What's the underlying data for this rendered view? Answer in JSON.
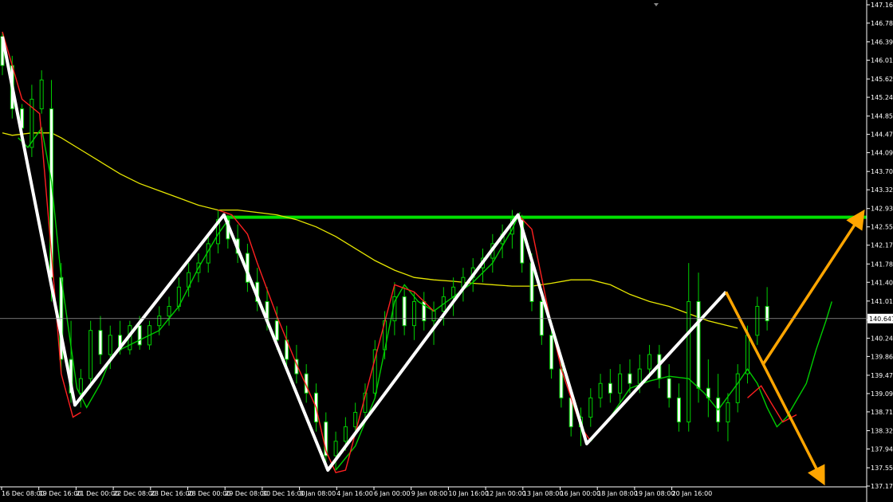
{
  "chart_data": {
    "type": "candlestick",
    "symbol_timeframe": "",
    "background": "#000000",
    "axis_color": "#ffffff",
    "ylim": [
      137.17,
      147.16
    ],
    "price_ticks": [
      "147.160",
      "146.780",
      "146.390",
      "146.010",
      "145.620",
      "145.240",
      "144.850",
      "144.470",
      "144.090",
      "143.700",
      "143.320",
      "142.930",
      "142.550",
      "142.170",
      "141.780",
      "141.400",
      "141.010",
      "140.620",
      "140.240",
      "139.860",
      "139.470",
      "139.090",
      "138.710",
      "138.320",
      "137.940",
      "137.550",
      "137.170"
    ],
    "current_price": {
      "label": "140.647",
      "value": 140.647,
      "color": "#ffffff"
    },
    "time_labels": [
      "16 Dec 08:00",
      "19 Dec 16:00",
      "21 Dec 00:00",
      "22 Dec 08:00",
      "23 Dec 16:00",
      "28 Dec 00:00",
      "29 Dec 08:00",
      "30 Dec 16:00",
      "3 Jan 08:00",
      "4 Jan 16:00",
      "6 Jan 00:00",
      "9 Jan 08:00",
      "10 Jan 16:00",
      "12 Jan 00:00",
      "13 Jan 08:00",
      "16 Jan 00:00",
      "18 Jan 08:00",
      "19 Jan 08:00",
      "20 Jan 16:00"
    ],
    "resistance_level": {
      "value": 142.75,
      "color": "#00e000"
    },
    "ma_long": {
      "color": "#e6e600",
      "points": [
        [
          0,
          144.5
        ],
        [
          0.5,
          144.45
        ],
        [
          1.5,
          144.5
        ],
        [
          2.5,
          144.5
        ],
        [
          3,
          144.4
        ],
        [
          4,
          144.15
        ],
        [
          5,
          143.9
        ],
        [
          6,
          143.65
        ],
        [
          7,
          143.45
        ],
        [
          8,
          143.3
        ],
        [
          9,
          143.15
        ],
        [
          10,
          143.0
        ],
        [
          11,
          142.9
        ],
        [
          12,
          142.9
        ],
        [
          13,
          142.85
        ],
        [
          14,
          142.8
        ],
        [
          15,
          142.7
        ],
        [
          16,
          142.55
        ],
        [
          17,
          142.35
        ],
        [
          18,
          142.1
        ],
        [
          19,
          141.85
        ],
        [
          20,
          141.65
        ],
        [
          21,
          141.5
        ],
        [
          22,
          141.45
        ],
        [
          23,
          141.42
        ],
        [
          24,
          141.38
        ],
        [
          25,
          141.35
        ],
        [
          26,
          141.32
        ],
        [
          27,
          141.32
        ],
        [
          28,
          141.38
        ],
        [
          29,
          141.45
        ],
        [
          30,
          141.45
        ],
        [
          31,
          141.35
        ],
        [
          32,
          141.15
        ],
        [
          33,
          141.0
        ],
        [
          34,
          140.9
        ],
        [
          35,
          140.75
        ],
        [
          36,
          140.6
        ],
        [
          37,
          140.5
        ],
        [
          37.5,
          140.45
        ]
      ]
    },
    "ma_fast_down": {
      "color": "#ff2020",
      "points": [
        [
          0,
          146.6
        ],
        [
          1,
          145.2
        ],
        [
          1.9,
          144.9
        ],
        [
          2.5,
          142.0
        ],
        [
          3,
          139.5
        ],
        [
          3.6,
          138.6
        ],
        [
          4,
          138.7
        ],
        [
          11,
          142.9
        ],
        [
          11.7,
          142.8
        ],
        [
          12.5,
          142.4
        ],
        [
          13,
          141.8
        ],
        [
          14,
          140.7
        ],
        [
          15,
          139.7
        ],
        [
          16,
          138.8
        ],
        [
          16.5,
          137.9
        ],
        [
          17,
          137.45
        ],
        [
          17.5,
          137.5
        ],
        [
          20,
          141.35
        ],
        [
          21,
          141.2
        ],
        [
          21.5,
          141.0
        ],
        [
          22,
          140.8
        ],
        [
          26.3,
          142.8
        ],
        [
          27,
          142.5
        ],
        [
          27.5,
          141.5
        ],
        [
          28,
          140.5
        ],
        [
          28.5,
          139.6
        ],
        [
          29,
          139.0
        ],
        [
          29.5,
          138.4
        ],
        [
          30,
          138.1
        ],
        [
          38,
          139.0
        ],
        [
          38.7,
          139.25
        ],
        [
          39.2,
          138.9
        ],
        [
          39.8,
          138.5
        ],
        [
          40.5,
          138.65
        ]
      ]
    },
    "ma_fast_up": {
      "color": "#00cc00",
      "points": [
        [
          0.8,
          144.4
        ],
        [
          1.3,
          144.2
        ],
        [
          2,
          144.6
        ],
        [
          2.5,
          143.5
        ],
        [
          3,
          141.5
        ],
        [
          3.8,
          139.2
        ],
        [
          4.3,
          138.8
        ],
        [
          5,
          139.3
        ],
        [
          5.5,
          139.8
        ],
        [
          6,
          140.0
        ],
        [
          7,
          140.2
        ],
        [
          8,
          140.4
        ],
        [
          9,
          140.9
        ],
        [
          10,
          141.7
        ],
        [
          11,
          142.4
        ],
        [
          11.7,
          142.8
        ],
        [
          17,
          137.5
        ],
        [
          18,
          138.0
        ],
        [
          19,
          139.0
        ],
        [
          19.5,
          140.0
        ],
        [
          20,
          141.0
        ],
        [
          20.5,
          141.35
        ],
        [
          21.2,
          141.0
        ],
        [
          22,
          140.8
        ],
        [
          23,
          141.1
        ],
        [
          24,
          141.4
        ],
        [
          25,
          141.8
        ],
        [
          26,
          142.5
        ],
        [
          26.4,
          142.85
        ],
        [
          30,
          138.1
        ],
        [
          31,
          138.6
        ],
        [
          32,
          139.2
        ],
        [
          33,
          139.35
        ],
        [
          34,
          139.45
        ],
        [
          35,
          139.4
        ],
        [
          35.8,
          139.1
        ],
        [
          36.5,
          138.75
        ],
        [
          37.5,
          139.3
        ],
        [
          38,
          139.6
        ],
        [
          38.5,
          139.3
        ],
        [
          39,
          138.8
        ],
        [
          39.5,
          138.4
        ],
        [
          40,
          138.6
        ],
        [
          40.5,
          138.95
        ],
        [
          41,
          139.3
        ],
        [
          41.5,
          140.0
        ],
        [
          42,
          140.6
        ],
        [
          42.3,
          141.0
        ]
      ]
    },
    "zigzag": {
      "color": "#ffffff",
      "points": [
        [
          0,
          146.5
        ],
        [
          3.7,
          138.85
        ],
        [
          11.3,
          142.8
        ],
        [
          16.6,
          137.5
        ],
        [
          26.3,
          142.8
        ],
        [
          29.8,
          138.05
        ],
        [
          36.9,
          141.2
        ]
      ]
    },
    "projection_arrows": {
      "color": "#ffa500",
      "paths": [
        [
          [
            36.9,
            141.2
          ],
          [
            38.8,
            139.7
          ],
          [
            43.8,
            142.8
          ]
        ],
        [
          [
            38.8,
            139.7
          ],
          [
            41.8,
            137.3
          ]
        ]
      ]
    },
    "candles": [
      {
        "t": 0,
        "o": 146.5,
        "h": 146.6,
        "l": 145.7,
        "c": 145.9
      },
      {
        "t": 0.5,
        "o": 145.9,
        "h": 146.1,
        "l": 144.8,
        "c": 145.0
      },
      {
        "t": 1,
        "o": 145.0,
        "h": 145.1,
        "l": 144.3,
        "c": 144.6
      },
      {
        "t": 1.5,
        "o": 144.2,
        "h": 145.5,
        "l": 144.0,
        "c": 145.2
      },
      {
        "t": 2,
        "o": 145.0,
        "h": 145.8,
        "l": 144.9,
        "c": 145.6
      },
      {
        "t": 2.5,
        "o": 145.0,
        "h": 145.6,
        "l": 141.0,
        "c": 141.5
      },
      {
        "t": 3,
        "o": 141.5,
        "h": 141.8,
        "l": 139.5,
        "c": 139.8
      },
      {
        "t": 3.5,
        "o": 139.8,
        "h": 140.6,
        "l": 138.9,
        "c": 139.1
      },
      {
        "t": 4,
        "o": 139.1,
        "h": 139.6,
        "l": 138.8,
        "c": 139.4
      },
      {
        "t": 4.5,
        "o": 139.4,
        "h": 140.6,
        "l": 139.2,
        "c": 140.4
      },
      {
        "t": 5,
        "o": 140.4,
        "h": 140.7,
        "l": 139.7,
        "c": 139.9
      },
      {
        "t": 5.5,
        "o": 139.9,
        "h": 140.5,
        "l": 139.6,
        "c": 140.3
      },
      {
        "t": 6,
        "o": 140.3,
        "h": 140.6,
        "l": 139.9,
        "c": 140.0
      },
      {
        "t": 6.5,
        "o": 140.0,
        "h": 140.6,
        "l": 139.9,
        "c": 140.5
      },
      {
        "t": 7,
        "o": 140.5,
        "h": 140.7,
        "l": 140.0,
        "c": 140.1
      },
      {
        "t": 7.5,
        "o": 140.1,
        "h": 140.6,
        "l": 140.0,
        "c": 140.5
      },
      {
        "t": 8,
        "o": 140.5,
        "h": 140.9,
        "l": 140.3,
        "c": 140.7
      },
      {
        "t": 8.5,
        "o": 140.7,
        "h": 141.1,
        "l": 140.5,
        "c": 140.9
      },
      {
        "t": 9,
        "o": 140.9,
        "h": 141.5,
        "l": 140.8,
        "c": 141.3
      },
      {
        "t": 9.5,
        "o": 141.3,
        "h": 141.8,
        "l": 141.1,
        "c": 141.6
      },
      {
        "t": 10,
        "o": 141.6,
        "h": 142.0,
        "l": 141.4,
        "c": 141.8
      },
      {
        "t": 10.5,
        "o": 141.8,
        "h": 142.4,
        "l": 141.6,
        "c": 142.2
      },
      {
        "t": 11,
        "o": 142.2,
        "h": 142.9,
        "l": 142.0,
        "c": 142.7
      },
      {
        "t": 11.5,
        "o": 142.7,
        "h": 142.8,
        "l": 142.1,
        "c": 142.3
      },
      {
        "t": 12,
        "o": 142.3,
        "h": 142.6,
        "l": 141.8,
        "c": 142.0
      },
      {
        "t": 12.5,
        "o": 142.0,
        "h": 142.2,
        "l": 141.2,
        "c": 141.4
      },
      {
        "t": 13,
        "o": 141.4,
        "h": 141.7,
        "l": 140.8,
        "c": 141.0
      },
      {
        "t": 13.5,
        "o": 141.0,
        "h": 141.3,
        "l": 140.4,
        "c": 140.6
      },
      {
        "t": 14,
        "o": 140.6,
        "h": 140.9,
        "l": 140.0,
        "c": 140.2
      },
      {
        "t": 14.5,
        "o": 140.2,
        "h": 140.5,
        "l": 139.6,
        "c": 139.8
      },
      {
        "t": 15,
        "o": 139.8,
        "h": 140.1,
        "l": 139.3,
        "c": 139.5
      },
      {
        "t": 15.5,
        "o": 139.5,
        "h": 139.7,
        "l": 138.9,
        "c": 139.1
      },
      {
        "t": 16,
        "o": 139.1,
        "h": 139.3,
        "l": 138.3,
        "c": 138.5
      },
      {
        "t": 16.5,
        "o": 138.5,
        "h": 138.7,
        "l": 137.6,
        "c": 137.8
      },
      {
        "t": 17,
        "o": 137.8,
        "h": 138.3,
        "l": 137.5,
        "c": 138.1
      },
      {
        "t": 17.5,
        "o": 138.1,
        "h": 138.6,
        "l": 137.9,
        "c": 138.4
      },
      {
        "t": 18,
        "o": 138.4,
        "h": 138.9,
        "l": 138.2,
        "c": 138.7
      },
      {
        "t": 18.5,
        "o": 138.7,
        "h": 139.3,
        "l": 138.5,
        "c": 139.1
      },
      {
        "t": 19,
        "o": 139.1,
        "h": 140.2,
        "l": 139.0,
        "c": 140.0
      },
      {
        "t": 19.5,
        "o": 140.0,
        "h": 140.8,
        "l": 139.8,
        "c": 140.6
      },
      {
        "t": 20,
        "o": 140.6,
        "h": 141.4,
        "l": 140.3,
        "c": 141.1
      },
      {
        "t": 20.5,
        "o": 141.1,
        "h": 141.3,
        "l": 140.3,
        "c": 140.5
      },
      {
        "t": 21,
        "o": 140.5,
        "h": 141.2,
        "l": 140.2,
        "c": 141.0
      },
      {
        "t": 21.5,
        "o": 141.0,
        "h": 141.2,
        "l": 140.4,
        "c": 140.6
      },
      {
        "t": 22,
        "o": 140.6,
        "h": 141.0,
        "l": 140.1,
        "c": 140.8
      },
      {
        "t": 22.5,
        "o": 140.8,
        "h": 141.3,
        "l": 140.5,
        "c": 141.1
      },
      {
        "t": 23,
        "o": 141.1,
        "h": 141.5,
        "l": 140.7,
        "c": 141.3
      },
      {
        "t": 23.5,
        "o": 141.3,
        "h": 141.7,
        "l": 141.0,
        "c": 141.5
      },
      {
        "t": 24,
        "o": 141.5,
        "h": 141.9,
        "l": 141.2,
        "c": 141.7
      },
      {
        "t": 24.5,
        "o": 141.7,
        "h": 142.1,
        "l": 141.4,
        "c": 141.9
      },
      {
        "t": 25,
        "o": 141.9,
        "h": 142.4,
        "l": 141.6,
        "c": 142.2
      },
      {
        "t": 25.5,
        "o": 142.2,
        "h": 142.6,
        "l": 141.9,
        "c": 142.4
      },
      {
        "t": 26,
        "o": 142.4,
        "h": 142.9,
        "l": 142.1,
        "c": 142.7
      },
      {
        "t": 26.5,
        "o": 142.7,
        "h": 142.8,
        "l": 141.6,
        "c": 141.8
      },
      {
        "t": 27,
        "o": 141.8,
        "h": 142.0,
        "l": 140.8,
        "c": 141.0
      },
      {
        "t": 27.5,
        "o": 141.0,
        "h": 141.2,
        "l": 140.1,
        "c": 140.3
      },
      {
        "t": 28,
        "o": 140.3,
        "h": 140.6,
        "l": 139.4,
        "c": 139.6
      },
      {
        "t": 28.5,
        "o": 139.6,
        "h": 139.9,
        "l": 138.8,
        "c": 139.0
      },
      {
        "t": 29,
        "o": 139.0,
        "h": 139.2,
        "l": 138.2,
        "c": 138.4
      },
      {
        "t": 29.5,
        "o": 138.4,
        "h": 138.8,
        "l": 138.0,
        "c": 138.6
      },
      {
        "t": 30,
        "o": 138.6,
        "h": 139.2,
        "l": 138.4,
        "c": 139.0
      },
      {
        "t": 30.5,
        "o": 139.0,
        "h": 139.5,
        "l": 138.8,
        "c": 139.3
      },
      {
        "t": 31,
        "o": 139.3,
        "h": 139.6,
        "l": 138.9,
        "c": 139.1
      },
      {
        "t": 31.5,
        "o": 139.1,
        "h": 139.7,
        "l": 138.9,
        "c": 139.5
      },
      {
        "t": 32,
        "o": 139.5,
        "h": 139.8,
        "l": 139.1,
        "c": 139.3
      },
      {
        "t": 32.5,
        "o": 139.3,
        "h": 139.9,
        "l": 139.1,
        "c": 139.6
      },
      {
        "t": 33,
        "o": 139.6,
        "h": 140.1,
        "l": 139.4,
        "c": 139.9
      },
      {
        "t": 33.5,
        "o": 139.9,
        "h": 140.1,
        "l": 139.2,
        "c": 139.4
      },
      {
        "t": 34,
        "o": 139.4,
        "h": 139.7,
        "l": 138.8,
        "c": 139.0
      },
      {
        "t": 34.5,
        "o": 139.0,
        "h": 139.3,
        "l": 138.3,
        "c": 138.5
      },
      {
        "t": 35,
        "o": 138.5,
        "h": 141.8,
        "l": 138.3,
        "c": 141.0
      },
      {
        "t": 35.5,
        "o": 141.0,
        "h": 141.6,
        "l": 138.9,
        "c": 139.2
      },
      {
        "t": 36,
        "o": 139.2,
        "h": 139.8,
        "l": 138.6,
        "c": 139.0
      },
      {
        "t": 36.5,
        "o": 139.0,
        "h": 139.5,
        "l": 138.3,
        "c": 138.5
      },
      {
        "t": 37,
        "o": 138.5,
        "h": 139.1,
        "l": 138.1,
        "c": 138.9
      },
      {
        "t": 37.5,
        "o": 138.9,
        "h": 139.7,
        "l": 138.7,
        "c": 139.5
      },
      {
        "t": 38,
        "o": 139.5,
        "h": 140.5,
        "l": 139.3,
        "c": 140.3
      },
      {
        "t": 38.5,
        "o": 140.3,
        "h": 141.1,
        "l": 140.1,
        "c": 140.9
      },
      {
        "t": 39,
        "o": 140.9,
        "h": 141.3,
        "l": 140.4,
        "c": 140.6
      }
    ]
  }
}
